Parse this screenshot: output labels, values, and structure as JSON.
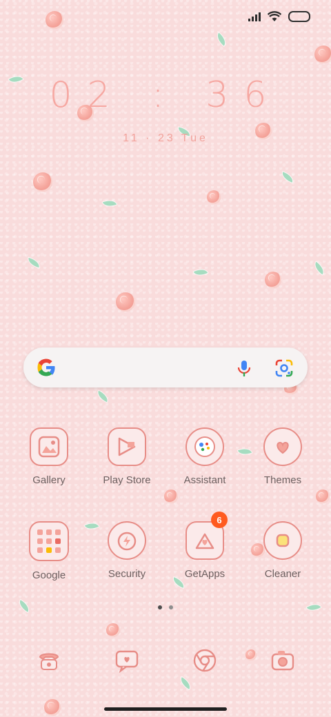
{
  "status_bar": {
    "signal_icon": "cell-signal-icon",
    "wifi_icon": "wifi-icon",
    "battery_icon": "battery-icon"
  },
  "clock": {
    "time": "02 : 36",
    "date": "11 · 23  Tue"
  },
  "search": {
    "logo_icon": "google-g-icon",
    "mic_icon": "microphone-icon",
    "lens_icon": "google-lens-icon"
  },
  "apps": [
    {
      "label": "Gallery",
      "icon": "gallery-icon"
    },
    {
      "label": "Play Store",
      "icon": "play-store-icon"
    },
    {
      "label": "Assistant",
      "icon": "assistant-icon"
    },
    {
      "label": "Themes",
      "icon": "themes-icon"
    },
    {
      "label": "Google",
      "icon": "google-folder-icon"
    },
    {
      "label": "Security",
      "icon": "security-icon"
    },
    {
      "label": "GetApps",
      "icon": "getapps-icon",
      "badge": "6"
    },
    {
      "label": "Cleaner",
      "icon": "cleaner-icon"
    }
  ],
  "page_indicator": {
    "pages": 2,
    "current": 1
  },
  "dock": [
    {
      "icon": "phone-icon"
    },
    {
      "icon": "messages-icon"
    },
    {
      "icon": "chrome-icon"
    },
    {
      "icon": "camera-icon"
    }
  ],
  "colors": {
    "wallpaper": "#f9dcdc",
    "accent": "#e78d87",
    "badge": "#ff5a1f"
  }
}
